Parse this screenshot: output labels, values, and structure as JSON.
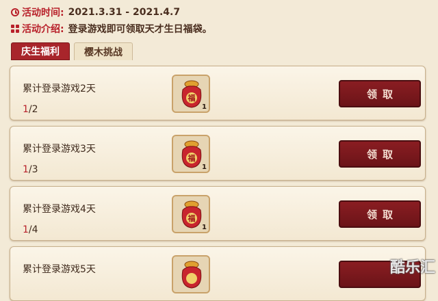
{
  "event": {
    "time_label": "活动时间:",
    "time_value": "2021.3.31 - 2021.4.7",
    "intro_label": "活动介绍:",
    "intro_value": "登录游戏即可领取天才生日福袋。"
  },
  "tabs": [
    {
      "label": "庆生福利",
      "active": true
    },
    {
      "label": "樱木挑战",
      "active": false
    }
  ],
  "tasks": [
    {
      "title": "累计登录游戏2天",
      "progress_current": "1",
      "progress_total": "/2",
      "reward_count": "1",
      "claim_label": "领取"
    },
    {
      "title": "累计登录游戏3天",
      "progress_current": "1",
      "progress_total": "/3",
      "reward_count": "1",
      "claim_label": "领取"
    },
    {
      "title": "累计登录游戏4天",
      "progress_current": "1",
      "progress_total": "/4",
      "reward_count": "1",
      "claim_label": "领取"
    },
    {
      "title": "累计登录游戏5天",
      "progress_current": "",
      "progress_total": "",
      "reward_count": "",
      "claim_label": ""
    }
  ],
  "reward_icon": {
    "name": "lucky-bag-icon",
    "glyph": "福"
  },
  "colors": {
    "accent": "#b8202a",
    "button": "#7a181c",
    "panel": "#f8f0e0"
  },
  "watermark": "酷乐汇"
}
